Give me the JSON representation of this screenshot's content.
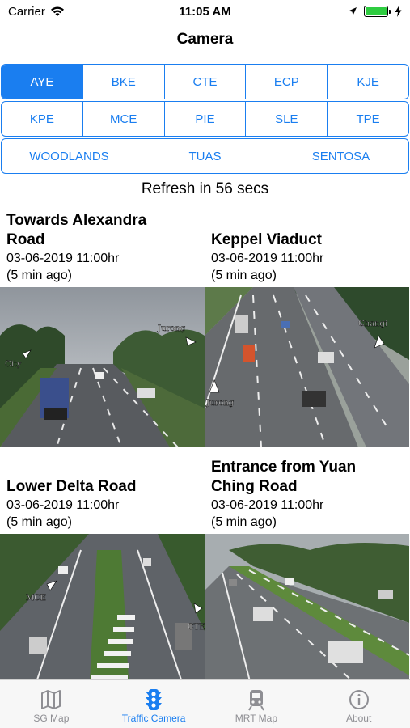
{
  "status": {
    "carrier": "Carrier",
    "time": "11:05 AM"
  },
  "nav": {
    "title": "Camera"
  },
  "segments": {
    "row1": [
      "AYE",
      "BKE",
      "CTE",
      "ECP",
      "KJE"
    ],
    "row2": [
      "KPE",
      "MCE",
      "PIE",
      "SLE",
      "TPE"
    ],
    "row3": [
      "WOODLANDS",
      "TUAS",
      "SENTOSA"
    ],
    "selected": "AYE"
  },
  "refresh_text": "Refresh in 56 secs",
  "cameras": [
    {
      "title_line1": "Towards Alexandra",
      "title_line2": "Road",
      "date": "03-06-2019 11:00hr",
      "ago": "(5 min ago)",
      "overlay_a": "City",
      "overlay_b": "Jurong"
    },
    {
      "title_line1": "Keppel Viaduct",
      "title_line2": "",
      "date": "03-06-2019 11:00hr",
      "ago": "(5 min ago)",
      "overlay_a": "Jurong",
      "overlay_b": "Changi"
    },
    {
      "title_line1": "Lower Delta Road",
      "title_line2": "",
      "date": "03-06-2019 11:00hr",
      "ago": "(5 min ago)",
      "overlay_a": "MCE",
      "overlay_b": "CTE"
    },
    {
      "title_line1": "Entrance from Yuan",
      "title_line2": "Ching Road",
      "date": "03-06-2019 11:00hr",
      "ago": "(5 min ago)",
      "overlay_a": "",
      "overlay_b": ""
    }
  ],
  "tabs": [
    {
      "label": "SG Map",
      "icon": "map-icon"
    },
    {
      "label": "Traffic Camera",
      "icon": "traffic-light-icon",
      "active": true
    },
    {
      "label": "MRT Map",
      "icon": "train-icon"
    },
    {
      "label": "About",
      "icon": "info-icon"
    }
  ],
  "colors": {
    "accent": "#1a7ef0",
    "inactive": "#8e8e93",
    "battery": "#2ecc40"
  }
}
